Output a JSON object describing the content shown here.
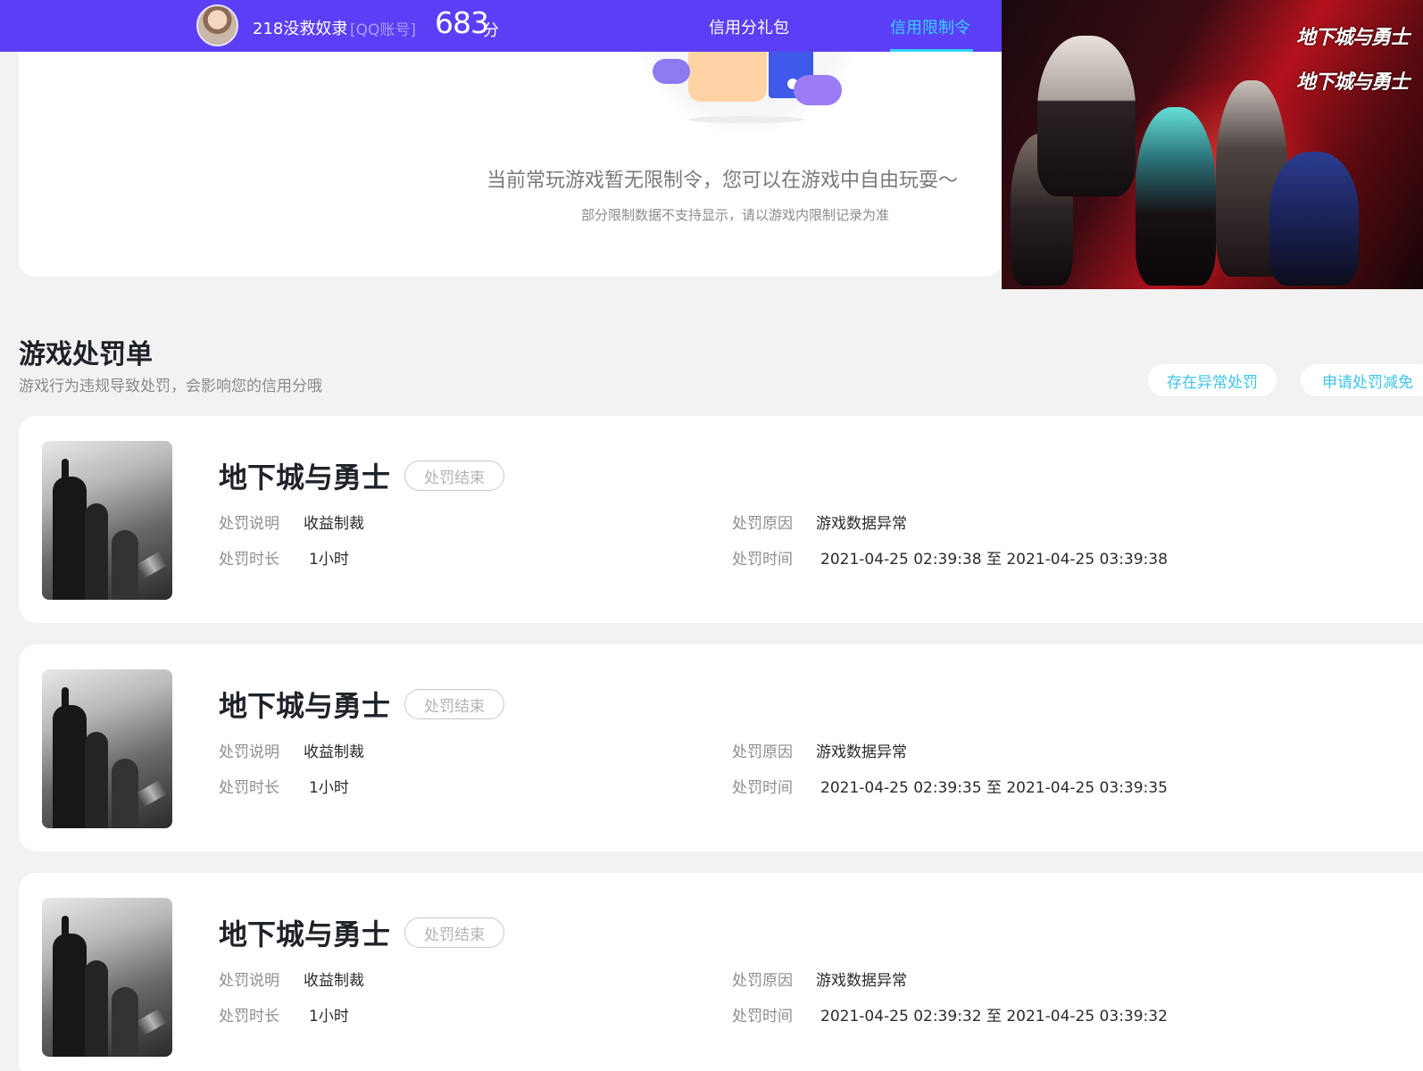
{
  "header": {
    "user_name": "218没救奴隶",
    "account_type": "[QQ账号]",
    "score_value": "683",
    "score_unit": "分",
    "tabs": [
      {
        "label": "信用分礼包",
        "active": false
      },
      {
        "label": "信用限制令",
        "active": true
      }
    ]
  },
  "promo": {
    "logo_text": "地下城与勇士"
  },
  "status_card": {
    "title": "当前常玩游戏暂无限制令，您可以在游戏中自由玩耍～",
    "subtitle": "部分限制数据不支持显示，请以游戏内限制记录为准"
  },
  "penalty_section": {
    "title": "游戏处罚单",
    "subtitle": "游戏行为违规导致处罚，会影响您的信用分哦",
    "anomaly_button": "存在异常处罚",
    "reduce_button": "申请处罚减免"
  },
  "labels": {
    "desc": "处罚说明",
    "duration": "处罚时长",
    "reason": "处罚原因",
    "time": "处罚时间"
  },
  "penalties": [
    {
      "game": "地下城与勇士",
      "status": "处罚结束",
      "desc": "收益制裁",
      "duration": "1小时",
      "reason": "游戏数据异常",
      "time": "2021-04-25 02:39:38 至 2021-04-25 03:39:38"
    },
    {
      "game": "地下城与勇士",
      "status": "处罚结束",
      "desc": "收益制裁",
      "duration": "1小时",
      "reason": "游戏数据异常",
      "time": "2021-04-25 02:39:35 至 2021-04-25 03:39:35"
    },
    {
      "game": "地下城与勇士",
      "status": "处罚结束",
      "desc": "收益制裁",
      "duration": "1小时",
      "reason": "游戏数据异常",
      "time": "2021-04-25 02:39:32 至 2021-04-25 03:39:32"
    }
  ],
  "colors": {
    "header_bg": "#5b3ef5",
    "active_tab": "#32d4ff",
    "pill_text": "#3fc4ea"
  }
}
